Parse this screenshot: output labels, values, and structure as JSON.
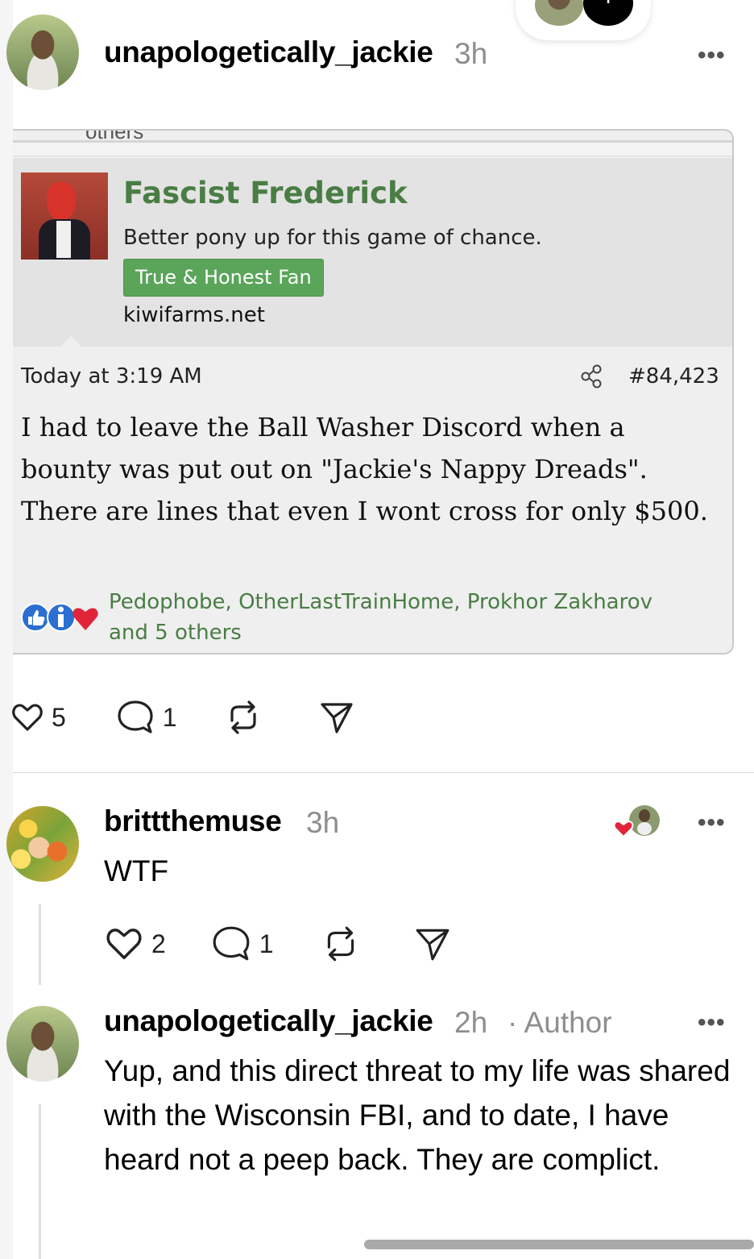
{
  "post": {
    "username": "unapologetically_jackie",
    "time": "3h",
    "more": "•••",
    "likes": "5",
    "comments": "1"
  },
  "screenshot": {
    "cut_text": "others",
    "user_name": "Fascist Frederick",
    "user_tagline": "Better pony up for this game of chance.",
    "user_badge": "True & Honest Fan",
    "site": "kiwifarms.net",
    "date": "Today at 3:19 AM",
    "post_number": "#84,423",
    "body": "I had to leave the Ball Washer Discord when a bounty was put out on \"Jackie's Nappy Dreads\". There are lines that even I wont cross for only $500.",
    "reactions_line1": "Pedophobe, OtherLastTrainHome, Prokhor Zakharov",
    "reactions_line2": "and 5 others",
    "colors": {
      "name_green": "#4a7d45",
      "badge_green": "#5aa55a"
    }
  },
  "replies": [
    {
      "username": "brittthemuse",
      "time": "3h",
      "text": "WTF",
      "likes": "2",
      "comments": "1",
      "more": "•••"
    },
    {
      "username": "unapologetically_jackie",
      "time": "2h",
      "author_label": "· Author",
      "text": "Yup, and this direct threat to my life was shared with the Wisconsin FBI, and to date, I have heard not a peep back. They are complict.",
      "more": "•••"
    }
  ],
  "top_pill": {
    "plus_icon": "+"
  },
  "icons": [
    "heart-icon",
    "comment-icon",
    "repost-icon",
    "share-send-icon",
    "share-node-icon",
    "more-icon"
  ],
  "colors": {
    "timestamp_gray": "#8e8e8e",
    "like_red": "#e0243a"
  }
}
